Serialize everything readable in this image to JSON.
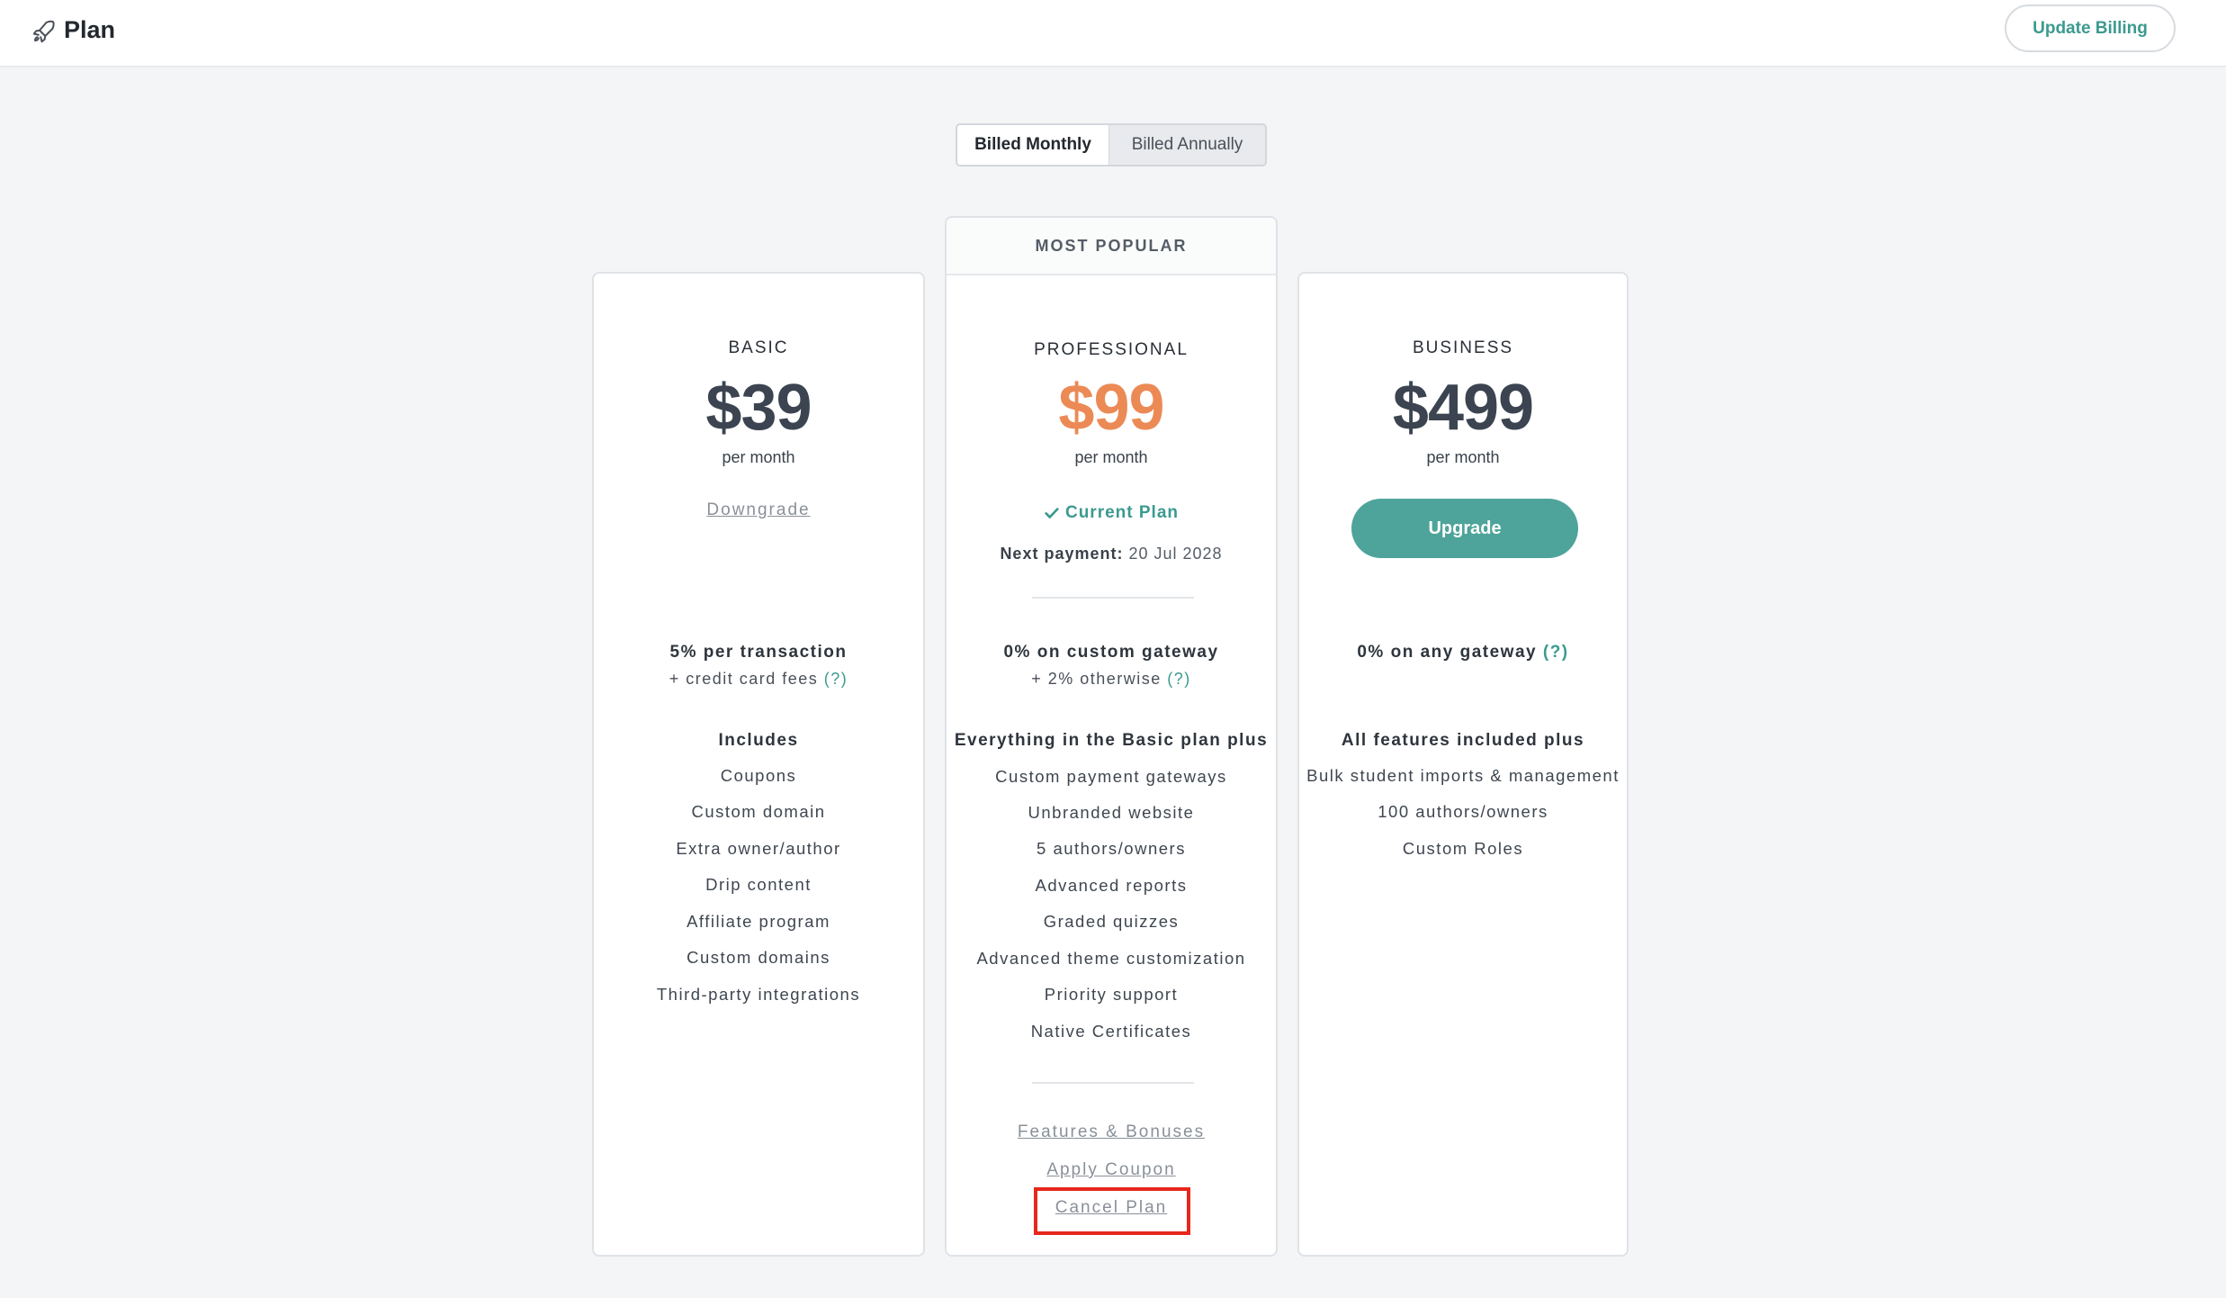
{
  "header": {
    "title": "Plan",
    "update_billing_label": "Update Billing"
  },
  "billing_toggle": {
    "monthly_label": "Billed Monthly",
    "annually_label": "Billed Annually",
    "selected": "Billed Monthly"
  },
  "plans": {
    "basic": {
      "name": "BASIC",
      "price": "$39",
      "period": "per month",
      "action_label": "Downgrade",
      "fee_main": "5% per transaction",
      "fee_sub": "+ credit card fees",
      "help": "(?)",
      "includes_heading": "Includes",
      "features": [
        "Coupons",
        "Custom domain",
        "Extra owner/author",
        "Drip content",
        "Affiliate program",
        "Custom domains",
        "Third-party integrations"
      ]
    },
    "professional": {
      "banner": "MOST POPULAR",
      "name": "PROFESSIONAL",
      "price": "$99",
      "period": "per month",
      "status_label": "Current Plan",
      "next_payment_label": "Next payment:",
      "next_payment_date": "20 Jul 2028",
      "fee_main": "0% on custom gateway",
      "fee_sub": "+ 2% otherwise",
      "help": "(?)",
      "includes_heading": "Everything in the Basic plan plus",
      "features": [
        "Custom payment gateways",
        "Unbranded website",
        "5 authors/owners",
        "Advanced reports",
        "Graded quizzes",
        "Advanced theme customization",
        "Priority support",
        "Native Certificates"
      ],
      "links": {
        "features_bonuses": "Features & Bonuses",
        "apply_coupon": "Apply Coupon",
        "cancel_plan": "Cancel Plan"
      }
    },
    "business": {
      "name": "BUSINESS",
      "price": "$499",
      "period": "per month",
      "action_label": "Upgrade",
      "fee_main": "0% on any gateway",
      "help": "(?)",
      "includes_heading": "All features included plus",
      "features": [
        "Bulk student imports & management",
        "100 authors/owners",
        "Custom Roles"
      ]
    }
  },
  "colors": {
    "accent": "#4ea49a",
    "pro_price": "#ec8a55",
    "highlight_border": "#e8271c"
  },
  "icons": {
    "header": "rocket-icon",
    "current_plan": "check-icon"
  }
}
